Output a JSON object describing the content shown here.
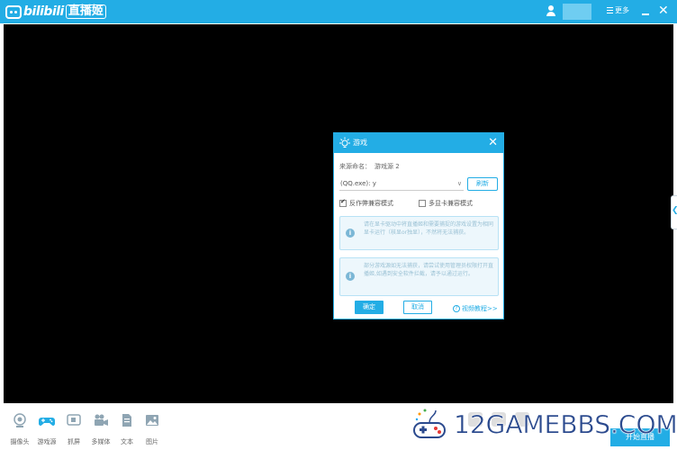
{
  "app": {
    "logo_brand": "bilibili",
    "logo_sub": "直播姬",
    "more_label": "更多"
  },
  "dialog": {
    "title": "游戏",
    "name_label": "来源命名：",
    "name_value": "游戏源 2",
    "select_value": "(QQ.exe): y",
    "refresh_label": "刷新",
    "check1_label": "反作弊兼容模式",
    "check1_checked": true,
    "check2_label": "多显卡兼容模式",
    "check2_checked": false,
    "info1": "请在显卡驱动中将直播姬和需要捕捉的游戏设置为相同显卡运行（核显or独显），不然将无法捕获。",
    "info2": "部分游戏源如无法捕获，请尝试使用管理员权限打开直播姬,如遇到安全软件拦截，请予以通过运行。",
    "ok_label": "确定",
    "cancel_label": "取消",
    "help_label": "视频教程>>"
  },
  "toolbar": [
    {
      "label": "摄像头",
      "icon": "camera-icon"
    },
    {
      "label": "游戏源",
      "icon": "gamepad-icon"
    },
    {
      "label": "抓屏",
      "icon": "screen-capture-icon"
    },
    {
      "label": "多媒体",
      "icon": "video-icon"
    },
    {
      "label": "文本",
      "icon": "text-icon"
    },
    {
      "label": "图片",
      "icon": "image-icon"
    }
  ],
  "start_label": "开始直播",
  "watermark": "12GAMEBBS.COM",
  "colors": {
    "accent": "#23ade5",
    "preview_bg": "#000000"
  }
}
